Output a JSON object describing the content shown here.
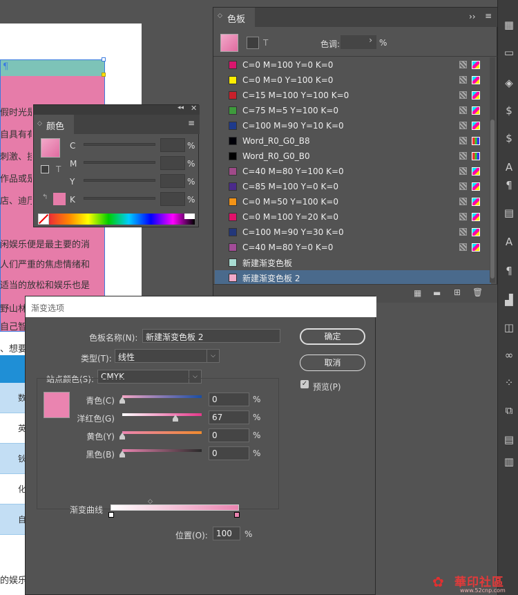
{
  "document": {
    "text_lines": [
      "假时光是",
      "自具有有",
      "刺激、挂",
      "作品或是",
      "店、迪厅",
      "闲娱乐便是最主要的消",
      "人们严重的焦虑情绪和",
      "适当的放松和娱乐也是",
      "野山林",
      "自己智",
      "、想要",
      "种不变"
    ],
    "footer_text": "的娱乐",
    "table_cells": [
      "数",
      "英",
      "钬",
      "化",
      "自"
    ]
  },
  "swatches_panel": {
    "tab_label": "色板",
    "tint_label": "色调:",
    "tint_value": "",
    "pct": "%",
    "rows": [
      {
        "name": "C=0 M=100 Y=0 K=0",
        "color": "#d9156d"
      },
      {
        "name": "C=0 M=0 Y=100 K=0",
        "color": "#ffed00"
      },
      {
        "name": "C=15 M=100 Y=100 K=0",
        "color": "#c8202b"
      },
      {
        "name": "C=75 M=5 Y=100 K=0",
        "color": "#3e9a3c"
      },
      {
        "name": "C=100 M=90 Y=10 K=0",
        "color": "#1e3a8c"
      },
      {
        "name": "Word_R0_G0_B8",
        "color": "#000008"
      },
      {
        "name": "Word_R0_G0_B0",
        "color": "#000000"
      },
      {
        "name": "C=40 M=80 Y=100 K=0",
        "color": "#a04a89"
      },
      {
        "name": "C=85 M=100 Y=0 K=0",
        "color": "#4b2a8a"
      },
      {
        "name": "C=0 M=50 Y=100 K=0",
        "color": "#f39316"
      },
      {
        "name": "C=0 M=100 Y=20 K=0",
        "color": "#e0116a"
      },
      {
        "name": "C=100 M=90 Y=30 K=0",
        "color": "#23377a"
      },
      {
        "name": "C=40 M=80 Y=0 K=0",
        "color": "#a34c98"
      },
      {
        "name": "新建渐变色板",
        "color": "#a8dcd2"
      },
      {
        "name": "新建渐变色板 2",
        "color": "#f2a9c9"
      }
    ]
  },
  "color_panel": {
    "tab_label": "颜色",
    "channels": [
      {
        "label": "C",
        "value": ""
      },
      {
        "label": "M",
        "value": ""
      },
      {
        "label": "Y",
        "value": ""
      },
      {
        "label": "K",
        "value": ""
      }
    ],
    "pct": "%"
  },
  "dialog": {
    "title": "渐变选项",
    "swatch_name_label": "色板名称(N):",
    "swatch_name_value": "新建渐变色板 2",
    "type_label": "类型(T):",
    "type_value": "线性",
    "stop_color_label": "站点颜色(S):",
    "stop_color_value": "CMYK",
    "channels": [
      {
        "label": "青色(C)",
        "value": "0",
        "level": 0,
        "gradient": "linear-gradient(90deg,#f4a6c5,#1a4da3)"
      },
      {
        "label": "洋红色(G)",
        "value": "67",
        "level": 0.67,
        "gradient": "linear-gradient(90deg,#ffffff,#e5388a)"
      },
      {
        "label": "黄色(Y)",
        "value": "0",
        "level": 0,
        "gradient": "linear-gradient(90deg,#ea84b0,#ef8a2e)"
      },
      {
        "label": "黑色(B)",
        "value": "0",
        "level": 0,
        "gradient": "linear-gradient(90deg,#ea84b0,#2a2a2a)"
      }
    ],
    "pct": "%",
    "ok_label": "确定",
    "cancel_label": "取消",
    "preview_label": "预览(P)",
    "preview_checked": true,
    "curve_label": "渐变曲线",
    "position_label": "位置(O):",
    "position_value": "100",
    "stop_color": "#ea84b0",
    "accent": "#e67ca9"
  },
  "watermark": {
    "text": "華印社區",
    "url": "www.52cnp.com"
  }
}
